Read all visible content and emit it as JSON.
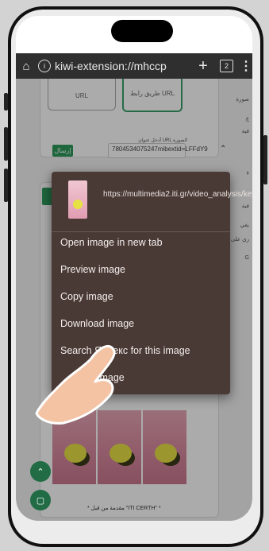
{
  "browser": {
    "url": "kiwi-extension://mhccp",
    "tab_count": "2",
    "home_icon": "home-icon",
    "info_icon": "info-icon",
    "plus_icon": "plus-icon",
    "menu_icon": "kebab-icon"
  },
  "page": {
    "url_option_label": "URL",
    "url_option_ar": "طريق رابط URL",
    "send_button": "إرسال",
    "url_input_label": "أدخل عنوان URL الصورة",
    "url_input_value": "7804534075247mibextid=LFFdY9",
    "side_labels": [
      "صورة",
      "ع",
      "فية",
      "ة",
      "فية",
      "يفي",
      "ري على الح",
      "G"
    ],
    "footer_note": "* مقدمة من قبل \"ITI CERTH\" *"
  },
  "context_menu": {
    "link": "https://multimedia2.iti.gr/video_analysis/keyframe/dce818553c...",
    "items": [
      "Open image in new tab",
      "Preview image",
      "Copy image",
      "Download image",
      "Search Яндекс for this image",
      "Image"
    ]
  }
}
